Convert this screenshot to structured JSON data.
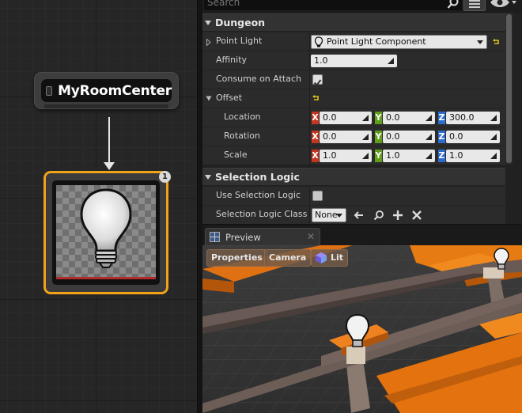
{
  "graph": {
    "marker_node_title": "MyRoomCenter",
    "visual_node_badge": "1"
  },
  "details": {
    "search_placeholder": "Search",
    "categories": {
      "dungeon": "Dungeon",
      "selection_logic": "Selection Logic"
    },
    "rows": {
      "point_light": {
        "label": "Point Light",
        "value": "Point Light Component"
      },
      "affinity": {
        "label": "Affinity",
        "value": "1.0"
      },
      "consume_on_attach": {
        "label": "Consume on Attach",
        "checked": true
      },
      "offset": {
        "label": "Offset"
      },
      "location": {
        "label": "Location",
        "x": "0.0",
        "y": "0.0",
        "z": "300.0"
      },
      "rotation": {
        "label": "Rotation",
        "x": "0.0",
        "y": "0.0",
        "z": "0.0"
      },
      "scale": {
        "label": "Scale",
        "x": "1.0",
        "y": "1.0",
        "z": "1.0"
      },
      "use_selection_logic": {
        "label": "Use Selection Logic",
        "checked": false
      },
      "selection_logic_class": {
        "label": "Selection Logic Class",
        "value": "None"
      }
    },
    "axis_letters": {
      "x": "X",
      "y": "Y",
      "z": "Z"
    }
  },
  "preview": {
    "tab_label": "Preview",
    "close_glyph": "✕",
    "buttons": {
      "properties": "Properties",
      "camera": "Camera",
      "lit": "Lit"
    }
  },
  "colors": {
    "selection_outline": "#f0a318",
    "axis_x": "#c4361f",
    "axis_y": "#5f9e19",
    "axis_z": "#2c6ccf",
    "seat_orange": "#e8730f"
  }
}
